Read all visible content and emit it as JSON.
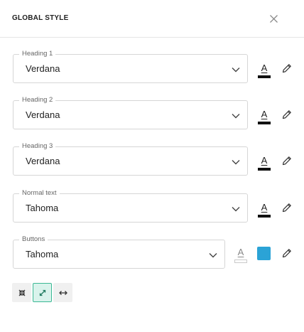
{
  "header": {
    "title": "GLOBAL STYLE"
  },
  "icons": {
    "close": "close-icon",
    "chevron": "chevron-down-icon",
    "font_color": "font-color-icon",
    "edit": "pencil-icon",
    "collapse": "collapse-icon",
    "expand": "expand-diagonal-icon",
    "width": "horizontal-resize-icon"
  },
  "colors": {
    "accent": "#3cb894",
    "button_color": "#2ba3d6",
    "font_color_default": "#111111",
    "border": "#d6d6d6"
  },
  "fields": [
    {
      "label": "Heading 1",
      "value": "Verdana",
      "font_color_letter": "A"
    },
    {
      "label": "Heading 2",
      "value": "Verdana",
      "font_color_letter": "A"
    },
    {
      "label": "Heading 3",
      "value": "Verdana",
      "font_color_letter": "A"
    },
    {
      "label": "Normal text",
      "value": "Tahoma",
      "font_color_letter": "A"
    },
    {
      "label": "Buttons",
      "value": "Tahoma",
      "font_color_letter": "A"
    }
  ],
  "toolbar": {
    "selected": "expand-diagonal"
  }
}
